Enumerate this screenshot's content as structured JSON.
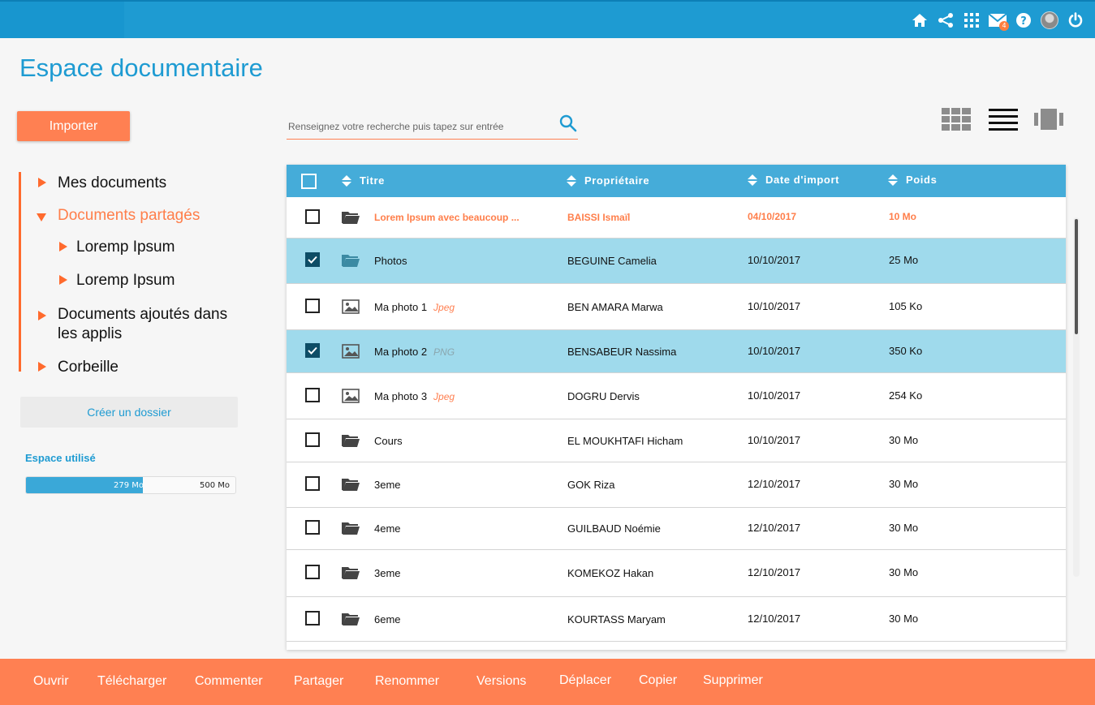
{
  "header": {
    "icons": [
      "home-icon",
      "share-icon",
      "apps-grid-icon",
      "mail-icon",
      "help-icon",
      "avatar",
      "power-icon"
    ],
    "mail_badge": "4"
  },
  "page": {
    "title": "Espace documentaire"
  },
  "toolbar": {
    "import_label": "Importer",
    "search_placeholder": "Renseignez votre recherche puis tapez sur entrée"
  },
  "nav": {
    "items": [
      {
        "label": "Mes documents"
      },
      {
        "label": "Documents partagés"
      },
      {
        "label": "Loremp Ipsum"
      },
      {
        "label": "Loremp Ipsum"
      },
      {
        "label": "Documents ajoutés dans"
      },
      {
        "label": "les applis"
      },
      {
        "label": "Corbeille"
      }
    ],
    "create_folder_label": "Créer un dossier"
  },
  "storage": {
    "label": "Espace utilisé",
    "used": "279 Mo",
    "total": "500 Mo",
    "fraction": 0.558
  },
  "table": {
    "headers": [
      "Titre",
      "Propriétaire",
      "Date d'import",
      "Poids"
    ],
    "rows": [
      {
        "title": "Lorem Ipsum avec beaucoup ...",
        "ext": "",
        "owner": "BAISSI Ismaïl",
        "date": "04/10/2017",
        "size": "10 Mo"
      },
      {
        "title": "Photos",
        "ext": "",
        "owner": "BEGUINE Camelia",
        "date": "10/10/2017",
        "size": "25 Mo"
      },
      {
        "title": "Ma photo 1",
        "ext": "Jpeg",
        "owner": "BEN AMARA Marwa",
        "date": "10/10/2017",
        "size": "105 Ko"
      },
      {
        "title": "Ma photo 2",
        "ext": "PNG",
        "owner": "BENSABEUR Nassima",
        "date": "10/10/2017",
        "size": "350 Ko"
      },
      {
        "title": "Ma photo 3",
        "ext": "Jpeg",
        "owner": "DOGRU Dervis",
        "date": "10/10/2017",
        "size": "254 Ko"
      },
      {
        "title": "Cours",
        "ext": "",
        "owner": "EL MOUKHTAFI Hicham",
        "date": "10/10/2017",
        "size": "30 Mo"
      },
      {
        "title": "3eme",
        "ext": "",
        "owner": "GOK Riza",
        "date": "12/10/2017",
        "size": "30 Mo"
      },
      {
        "title": "4eme",
        "ext": "",
        "owner": "GUILBAUD Noémie",
        "date": "12/10/2017",
        "size": "30 Mo"
      },
      {
        "title": "3eme",
        "ext": "",
        "owner": "KOMEKOZ Hakan",
        "date": "12/10/2017",
        "size": "30 Mo"
      },
      {
        "title": "6eme",
        "ext": "",
        "owner": "KOURTASS Maryam",
        "date": "12/10/2017",
        "size": "30 Mo"
      }
    ]
  },
  "actions": [
    "Ouvrir",
    "Télécharger",
    "Commenter",
    "Partager",
    "Renommer",
    "Versions",
    "Déplacer",
    "Copier",
    "Supprimer"
  ],
  "colors": {
    "primary": "#1e9bd2",
    "accent": "#ff8052",
    "selected_row": "#9fdaec"
  }
}
